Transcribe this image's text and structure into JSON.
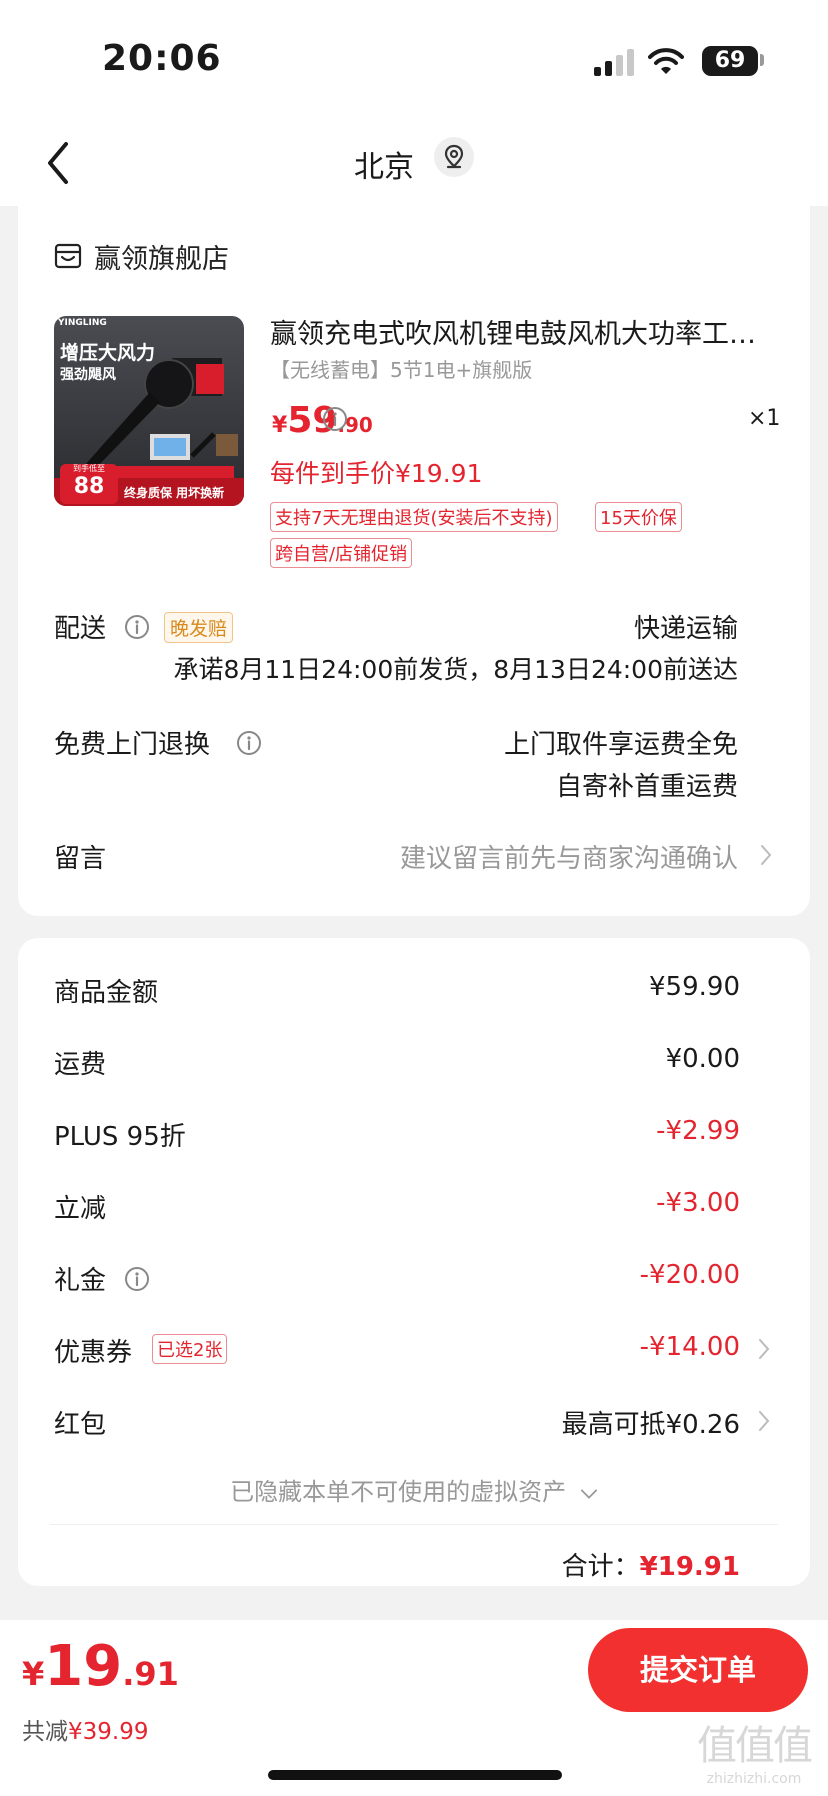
{
  "status_bar": {
    "time": "20:06",
    "battery": "69"
  },
  "nav": {
    "title": "北京"
  },
  "store": {
    "name": "赢领旗舰店"
  },
  "product": {
    "name": "赢领充电式吹风机锂电鼓风机大功率工…",
    "spec": "【无线蓄电】5节1电+旗舰版",
    "price_symbol": "¥",
    "price_int": "59",
    "price_dec": ".90",
    "quantity": "×1",
    "per_unit_price": "每件到手价¥19.91",
    "tags": [
      "支持7天无理由退货(安装后不支持)",
      "15天价保",
      "跨自营/店铺促销"
    ],
    "image": {
      "brand": "YINGLING",
      "headline": "增压大风力",
      "subline": "强劲飓风",
      "badge_number": "88",
      "badge_label": "到手低至",
      "footer": "终身质保 用坏换新",
      "colors": {
        "bg": "#3b3d42",
        "accent": "#d81e2c"
      }
    }
  },
  "delivery": {
    "label": "配送",
    "late_tag": "晚发赔",
    "method": "快递运输",
    "promise": "承诺8月11日24:00前发货，8月13日24:00前送达"
  },
  "returns": {
    "label": "免费上门退换",
    "line1": "上门取件享运费全免",
    "line2": "自寄补首重运费"
  },
  "note": {
    "label": "留言",
    "placeholder": "建议留言前先与商家沟通确认"
  },
  "summary": {
    "goods_label": "商品金额",
    "goods_value": "¥59.90",
    "shipping_label": "运费",
    "shipping_value": "¥0.00",
    "plus_label": "PLUS 95折",
    "plus_value": "-¥2.99",
    "instant_label": "立减",
    "instant_value": "-¥3.00",
    "gift_label": "礼金",
    "gift_value": "-¥20.00",
    "coupon_label": "优惠券",
    "coupon_tag": "已选2张",
    "coupon_value": "-¥14.00",
    "redpacket_label": "红包",
    "redpacket_value": "最高可抵¥0.26",
    "hidden_assets": "已隐藏本单不可使用的虚拟资产",
    "total_label": "合计：",
    "total_value": "¥19.91"
  },
  "bottom": {
    "price_symbol": "¥",
    "price_int": "19",
    "price_dec": ".91",
    "saved_label": "共减",
    "saved_value": "¥39.99",
    "submit": "提交订单"
  },
  "watermark": {
    "line1": "值值值",
    "line2": "zhizhizhi.com"
  },
  "colors": {
    "accent_red": "#e4252f",
    "button_red": "#f23030",
    "late_orange": "#d98a1e"
  }
}
